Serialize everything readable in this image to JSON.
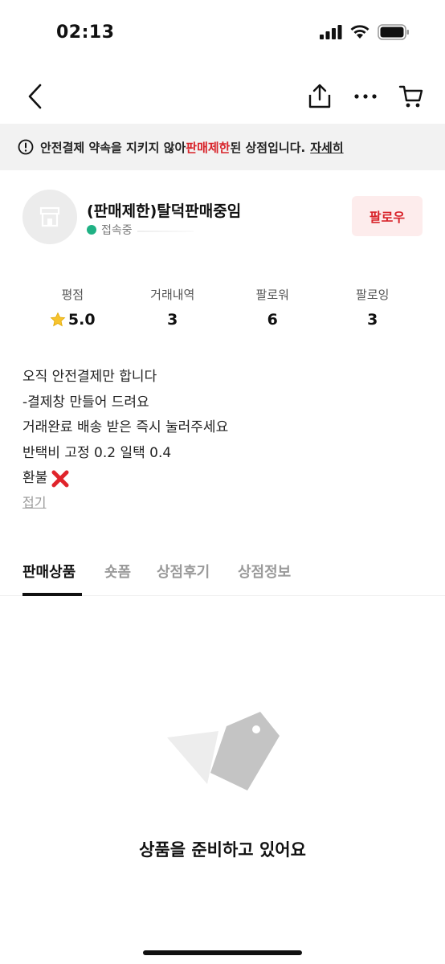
{
  "status_bar": {
    "time": "02:13"
  },
  "banner": {
    "prefix": "안전결제 약속을 지키지 않아 ",
    "highlight": "판매제한",
    "suffix": "된 상점입니다.",
    "link": "자세히"
  },
  "profile": {
    "name": "(판매제한)탈덕판매중임",
    "status": "접속중",
    "follow_label": "팔로우"
  },
  "stats": [
    {
      "label": "평점",
      "value": "5.0"
    },
    {
      "label": "거래내역",
      "value": "3"
    },
    {
      "label": "팔로워",
      "value": "6"
    },
    {
      "label": "팔로잉",
      "value": "3"
    }
  ],
  "description": {
    "lines": [
      "오직 안전결제만 합니다",
      "-결제창 만들어 드려요",
      "거래완료 배송 받은 즉시 눌러주세요",
      "반택비 고정 0.2 일택 0.4",
      "환불"
    ],
    "fold_label": "접기"
  },
  "tabs": [
    {
      "label": "판매상품"
    },
    {
      "label": "숏폼"
    },
    {
      "label": "상점후기"
    },
    {
      "label": "상점정보"
    }
  ],
  "empty_state": {
    "message": "상품을 준비하고 있어요"
  },
  "colors": {
    "accent_red": "#d8232a",
    "online_green": "#1fb184",
    "banner_bg": "#f2f2f2"
  }
}
